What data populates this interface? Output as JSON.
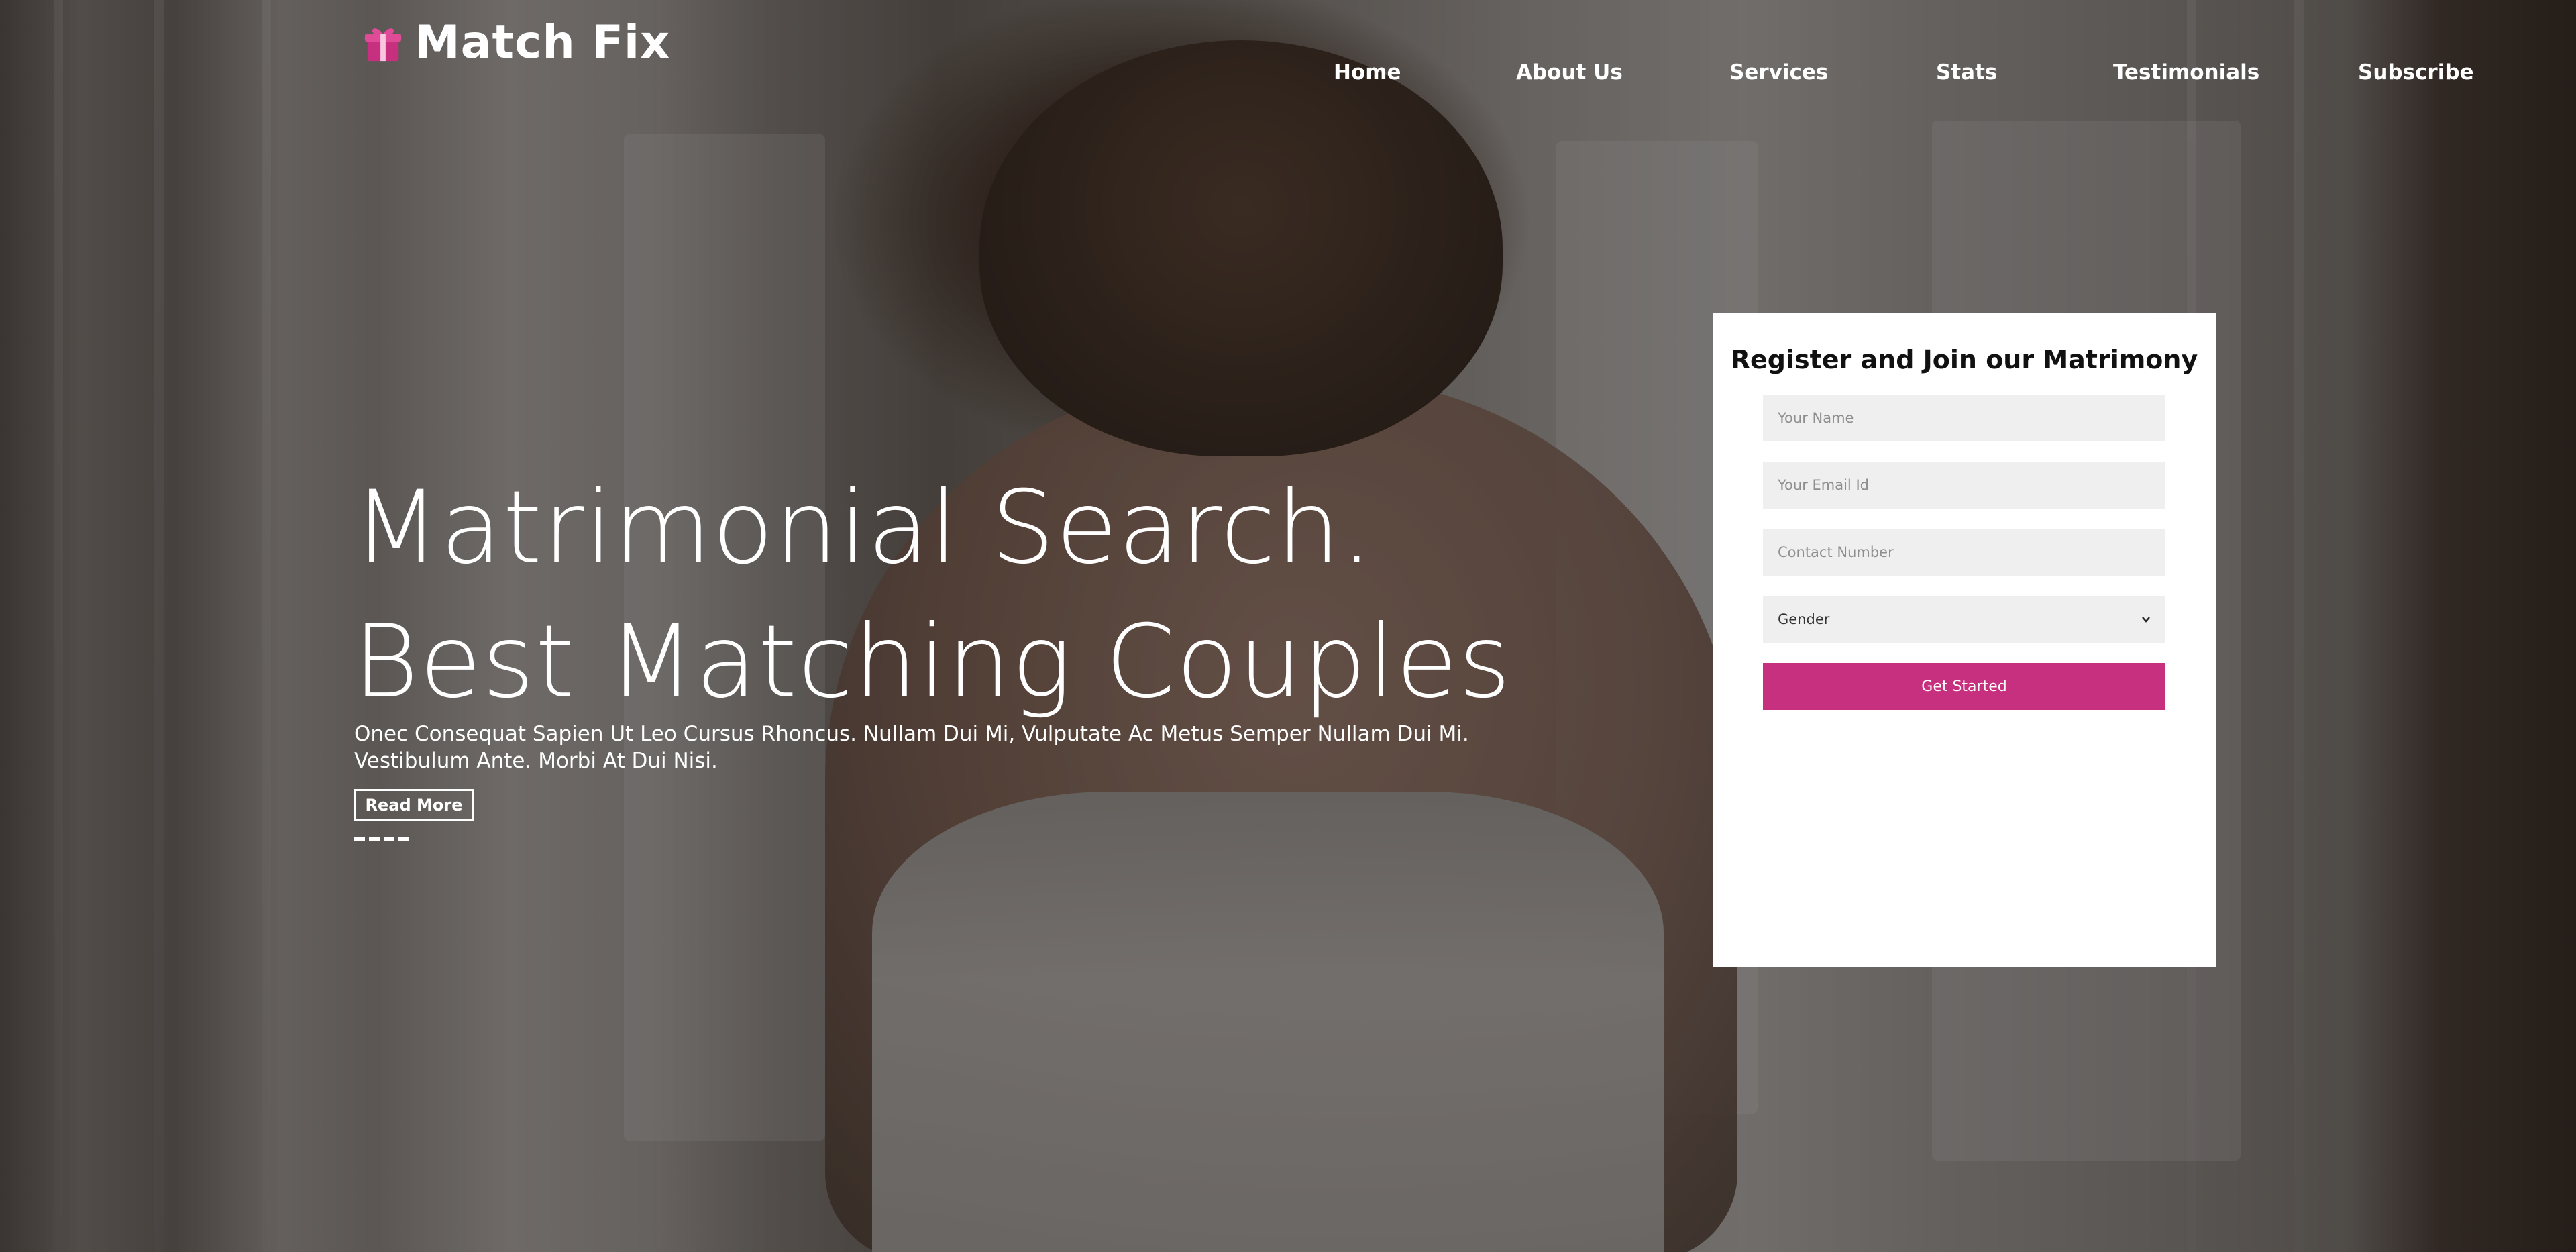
{
  "brand": {
    "name": "Match Fix",
    "icon": "gift-icon",
    "icon_color": "#c72f7f"
  },
  "nav": {
    "items": [
      {
        "label": "Home"
      },
      {
        "label": "About Us"
      },
      {
        "label": "Services"
      },
      {
        "label": "Stats"
      },
      {
        "label": "Testimonials"
      },
      {
        "label": "Subscribe"
      }
    ]
  },
  "hero": {
    "headline_1": "Matrimonial Search.",
    "headline_2": "Best Matching Couples",
    "description": "Onec Consequat Sapien Ut Leo Cursus Rhoncus. Nullam Dui Mi, Vulputate Ac Metus Semper Nullam Dui Mi. Vestibulum Ante. Morbi At Dui Nisi.",
    "read_more_label": "Read More",
    "slider_dots": 4
  },
  "form": {
    "title": "Register and Join our Matrimony",
    "name_placeholder": "Your Name",
    "email_placeholder": "Your Email Id",
    "contact_placeholder": "Contact Number",
    "gender_selected": "Gender",
    "submit_label": "Get Started"
  },
  "colors": {
    "accent": "#c72f7f",
    "text_on_dark": "#ffffff",
    "field_bg": "#efefef"
  }
}
